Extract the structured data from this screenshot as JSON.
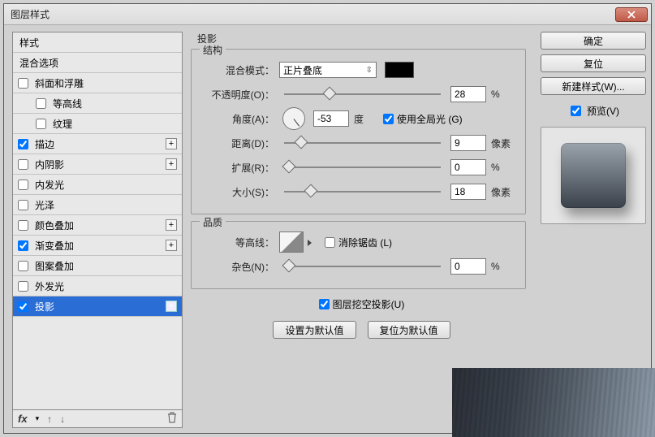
{
  "window": {
    "title": "图层样式",
    "close_icon": "close"
  },
  "sidebar": {
    "head_styles": "样式",
    "head_blend": "混合选项",
    "items": [
      {
        "label": "斜面和浮雕",
        "checked": false,
        "sub": false,
        "plus": false
      },
      {
        "label": "等高线",
        "checked": false,
        "sub": true,
        "plus": false
      },
      {
        "label": "纹理",
        "checked": false,
        "sub": true,
        "plus": false
      },
      {
        "label": "描边",
        "checked": true,
        "sub": false,
        "plus": true
      },
      {
        "label": "内阴影",
        "checked": false,
        "sub": false,
        "plus": true
      },
      {
        "label": "内发光",
        "checked": false,
        "sub": false,
        "plus": false
      },
      {
        "label": "光泽",
        "checked": false,
        "sub": false,
        "plus": false
      },
      {
        "label": "颜色叠加",
        "checked": false,
        "sub": false,
        "plus": true
      },
      {
        "label": "渐变叠加",
        "checked": true,
        "sub": false,
        "plus": true
      },
      {
        "label": "图案叠加",
        "checked": false,
        "sub": false,
        "plus": false
      },
      {
        "label": "外发光",
        "checked": false,
        "sub": false,
        "plus": false
      },
      {
        "label": "投影",
        "checked": true,
        "sub": false,
        "plus": true,
        "selected": true
      }
    ],
    "footer": {
      "fx": "fx"
    }
  },
  "panel": {
    "heading": "投影",
    "structure_legend": "结构",
    "blendmode_label": "混合模式：",
    "blendmode_value": "正片叠底",
    "opacity_label": "不透明度(O)：",
    "opacity_value": "28",
    "opacity_unit": "%",
    "angle_label": "角度(A)：",
    "angle_value": "-53",
    "angle_unit": "度",
    "global_light_label": "使用全局光 (G)",
    "global_light_checked": true,
    "distance_label": "距离(D)：",
    "distance_value": "9",
    "distance_unit": "像素",
    "spread_label": "扩展(R)：",
    "spread_value": "0",
    "spread_unit": "%",
    "size_label": "大小(S)：",
    "size_value": "18",
    "size_unit": "像素",
    "quality_legend": "品质",
    "contour_label": "等高线：",
    "antialias_label": "消除锯齿 (L)",
    "antialias_checked": false,
    "noise_label": "杂色(N)：",
    "noise_value": "0",
    "noise_unit": "%",
    "knockout_label": "图层挖空投影(U)",
    "knockout_checked": true,
    "btn_default": "设置为默认值",
    "btn_reset": "复位为默认值"
  },
  "right": {
    "ok": "确定",
    "reset": "复位",
    "newstyle": "新建样式(W)...",
    "preview_label": "预览(V)",
    "preview_checked": true
  }
}
